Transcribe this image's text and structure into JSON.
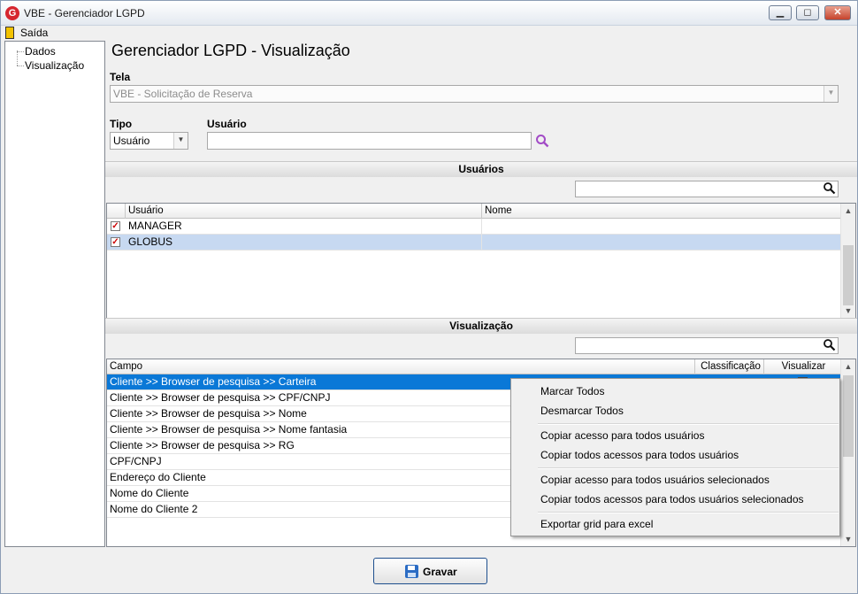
{
  "window": {
    "title": "VBE - Gerenciador LGPD",
    "app_icon_letter": "G",
    "minimize": "▁",
    "maximize": "◻",
    "close": "✕"
  },
  "menu": {
    "saida": "Saída"
  },
  "tree": {
    "items": [
      "Dados",
      "Visualização"
    ]
  },
  "page_title": "Gerenciador LGPD - Visualização",
  "tela": {
    "label": "Tela",
    "value": "VBE - Solicitação de Reserva"
  },
  "tipo": {
    "label": "Tipo",
    "value": "Usuário"
  },
  "usuario": {
    "label": "Usuário",
    "value": ""
  },
  "usuarios_section": {
    "title": "Usuários",
    "columns": [
      "Usuário",
      "Nome"
    ],
    "rows": [
      {
        "usuario": "MANAGER",
        "nome": "",
        "checked": true
      },
      {
        "usuario": "GLOBUS",
        "nome": "",
        "checked": true
      }
    ]
  },
  "visualizacao_section": {
    "title": "Visualização",
    "columns": [
      "Campo",
      "Classificação",
      "Visualizar"
    ],
    "rows": [
      "Cliente >> Browser de pesquisa >> Carteira",
      "Cliente >> Browser de pesquisa >> CPF/CNPJ",
      "Cliente >> Browser de pesquisa >> Nome",
      "Cliente >> Browser de pesquisa >> Nome fantasia",
      "Cliente >> Browser de pesquisa >> RG",
      "CPF/CNPJ",
      "Endereço do Cliente",
      "Nome do Cliente",
      "Nome do Cliente 2"
    ]
  },
  "context_menu": {
    "items": [
      "Marcar Todos",
      "Desmarcar Todos",
      "Copiar acesso para todos usuários",
      "Copiar todos acessos para todos usuários",
      "Copiar acesso para todos usuários selecionados",
      "Copiar todos acessos para todos usuários selecionados",
      "Exportar grid para excel"
    ]
  },
  "buttons": {
    "gravar": "Gravar"
  },
  "colors": {
    "selection": "#0a78d7",
    "selection_light": "#c7d9f1",
    "accent_search": "#a24bc6"
  }
}
